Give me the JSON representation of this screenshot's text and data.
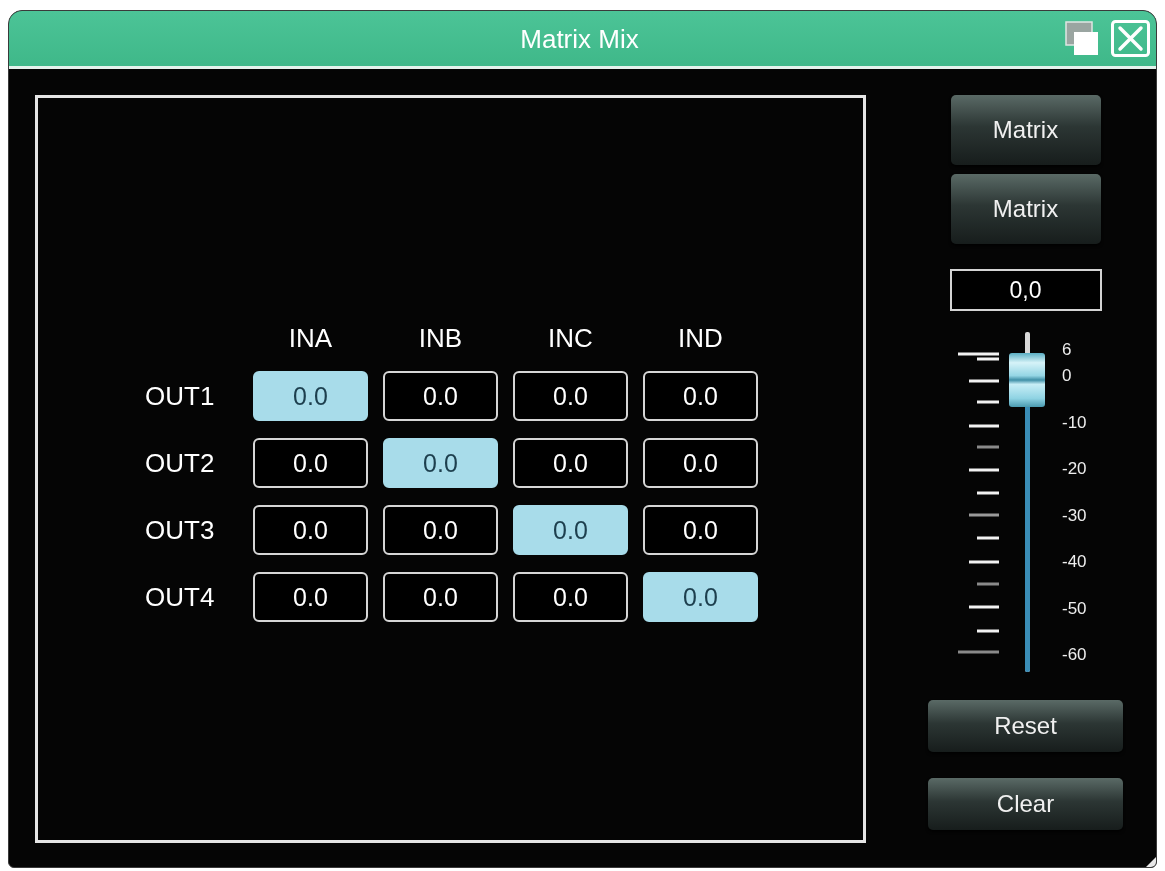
{
  "window": {
    "title": "Matrix Mix"
  },
  "matrix": {
    "columns": [
      "INA",
      "INB",
      "INC",
      "IND"
    ],
    "rows": [
      {
        "label": "OUT1",
        "cells": [
          {
            "value": "0.0",
            "selected": true
          },
          {
            "value": "0.0",
            "selected": false
          },
          {
            "value": "0.0",
            "selected": false
          },
          {
            "value": "0.0",
            "selected": false
          }
        ]
      },
      {
        "label": "OUT2",
        "cells": [
          {
            "value": "0.0",
            "selected": false
          },
          {
            "value": "0.0",
            "selected": true
          },
          {
            "value": "0.0",
            "selected": false
          },
          {
            "value": "0.0",
            "selected": false
          }
        ]
      },
      {
        "label": "OUT3",
        "cells": [
          {
            "value": "0.0",
            "selected": false
          },
          {
            "value": "0.0",
            "selected": false
          },
          {
            "value": "0.0",
            "selected": true
          },
          {
            "value": "0.0",
            "selected": false
          }
        ]
      },
      {
        "label": "OUT4",
        "cells": [
          {
            "value": "0.0",
            "selected": false
          },
          {
            "value": "0.0",
            "selected": false
          },
          {
            "value": "0.0",
            "selected": false
          },
          {
            "value": "0.0",
            "selected": true
          }
        ]
      }
    ]
  },
  "controls": {
    "mode_buttons": [
      "Matrix",
      "Matrix"
    ],
    "gain_field": {
      "value": "0,0"
    },
    "fader": {
      "level": 0.86,
      "scale": [
        "6",
        "0",
        "-10",
        "-20",
        "-30",
        "-40",
        "-50",
        "-60"
      ]
    },
    "actions": [
      "Reset",
      "Clear"
    ]
  }
}
